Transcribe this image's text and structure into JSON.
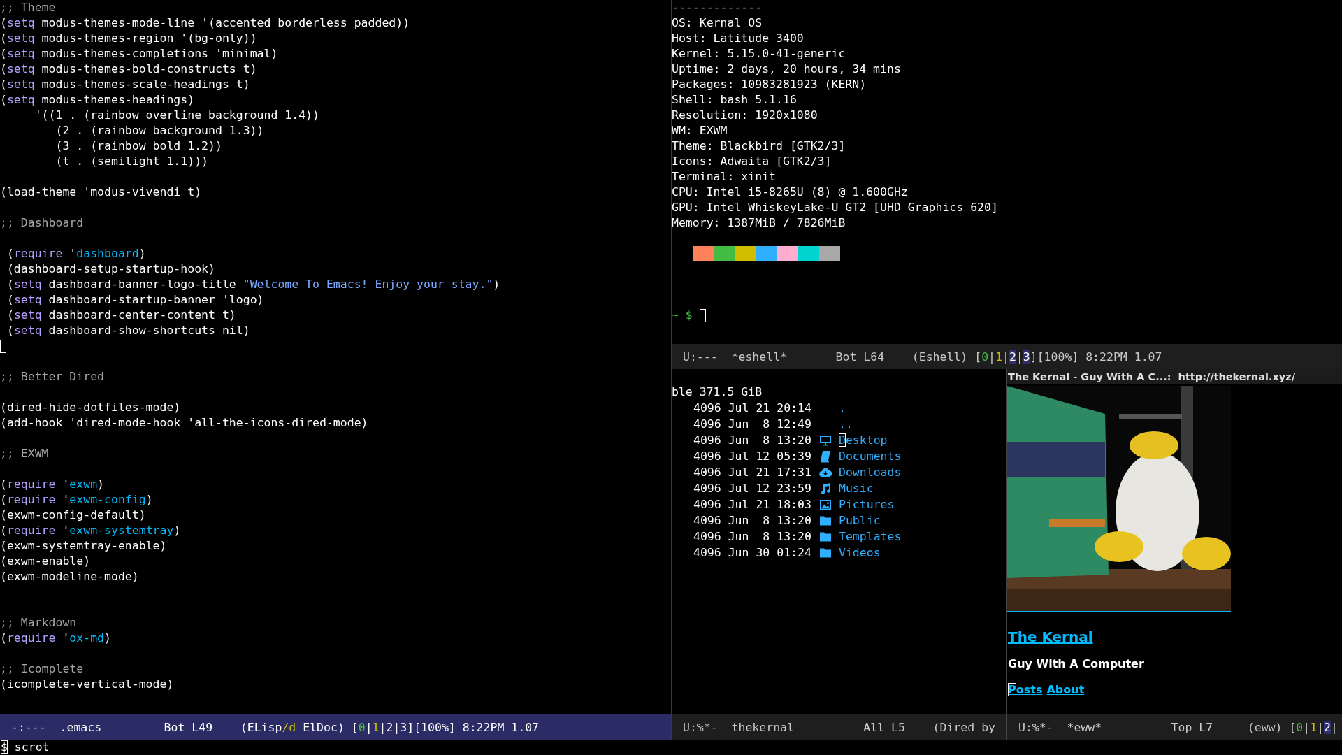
{
  "editor": {
    "lines": [
      {
        "kind": "code",
        "segments": [
          {
            "text": ";; Theme",
            "kind": "comment"
          }
        ]
      },
      {
        "kind": "code",
        "segments": [
          {
            "text": "("
          },
          {
            "text": "setq",
            "kind": "keyword"
          },
          {
            "text": " modus-themes-mode-line '(accented borderless padded))"
          }
        ]
      },
      {
        "kind": "code",
        "segments": [
          {
            "text": "("
          },
          {
            "text": "setq",
            "kind": "keyword"
          },
          {
            "text": " modus-themes-region '(bg-only))"
          }
        ]
      },
      {
        "kind": "code",
        "segments": [
          {
            "text": "("
          },
          {
            "text": "setq",
            "kind": "keyword"
          },
          {
            "text": " modus-themes-completions 'minimal)"
          }
        ]
      },
      {
        "kind": "code",
        "segments": [
          {
            "text": "("
          },
          {
            "text": "setq",
            "kind": "keyword"
          },
          {
            "text": " modus-themes-bold-constructs t)"
          }
        ]
      },
      {
        "kind": "code",
        "segments": [
          {
            "text": "("
          },
          {
            "text": "setq",
            "kind": "keyword"
          },
          {
            "text": " modus-themes-scale-headings t)"
          }
        ]
      },
      {
        "kind": "code",
        "segments": [
          {
            "text": "("
          },
          {
            "text": "setq",
            "kind": "keyword"
          },
          {
            "text": " modus-themes-headings)"
          }
        ]
      },
      {
        "kind": "code",
        "segments": [
          {
            "text": "     '((1 . (rainbow overline background 1.4))"
          }
        ]
      },
      {
        "kind": "code",
        "segments": [
          {
            "text": "        (2 . (rainbow background 1.3))"
          }
        ]
      },
      {
        "kind": "code",
        "segments": [
          {
            "text": "        (3 . (rainbow bold 1.2))"
          }
        ]
      },
      {
        "kind": "code",
        "segments": [
          {
            "text": "        (t . (semilight 1.1)))"
          }
        ]
      },
      {
        "kind": "blank"
      },
      {
        "kind": "code",
        "segments": [
          {
            "text": "(load-theme 'modus-vivendi t)"
          }
        ]
      },
      {
        "kind": "blank"
      },
      {
        "kind": "code",
        "segments": [
          {
            "text": ";; Dashboard",
            "kind": "comment"
          }
        ]
      },
      {
        "kind": "blank"
      },
      {
        "kind": "code",
        "segments": [
          {
            "text": " ("
          },
          {
            "text": "require",
            "kind": "keyword"
          },
          {
            "text": " '"
          },
          {
            "text": "dashboard",
            "kind": "constant"
          },
          {
            "text": ")"
          }
        ]
      },
      {
        "kind": "code",
        "segments": [
          {
            "text": " (dashboard-setup-startup-hook)"
          }
        ]
      },
      {
        "kind": "code",
        "segments": [
          {
            "text": " ("
          },
          {
            "text": "setq",
            "kind": "keyword"
          },
          {
            "text": " dashboard-banner-logo-title "
          },
          {
            "text": "\"Welcome To Emacs! Enjoy your stay.\"",
            "kind": "string"
          },
          {
            "text": ")"
          }
        ]
      },
      {
        "kind": "code",
        "segments": [
          {
            "text": " ("
          },
          {
            "text": "setq",
            "kind": "keyword"
          },
          {
            "text": " dashboard-startup-banner 'logo)"
          }
        ]
      },
      {
        "kind": "code",
        "segments": [
          {
            "text": " ("
          },
          {
            "text": "setq",
            "kind": "keyword"
          },
          {
            "text": " dashboard-center-content t)"
          }
        ]
      },
      {
        "kind": "code",
        "segments": [
          {
            "text": " ("
          },
          {
            "text": "setq",
            "kind": "keyword"
          },
          {
            "text": " dashboard-show-shortcuts nil)"
          }
        ]
      },
      {
        "kind": "cursor"
      },
      {
        "kind": "blank"
      },
      {
        "kind": "code",
        "segments": [
          {
            "text": ";; Better Dired",
            "kind": "comment"
          }
        ]
      },
      {
        "kind": "blank"
      },
      {
        "kind": "code",
        "segments": [
          {
            "text": "(dired-hide-dotfiles-mode)"
          }
        ]
      },
      {
        "kind": "code",
        "segments": [
          {
            "text": "(add-hook 'dired-mode-hook 'all-the-icons-dired-mode)"
          }
        ]
      },
      {
        "kind": "blank"
      },
      {
        "kind": "code",
        "segments": [
          {
            "text": ";; EXWM",
            "kind": "comment"
          }
        ]
      },
      {
        "kind": "blank"
      },
      {
        "kind": "code",
        "segments": [
          {
            "text": "("
          },
          {
            "text": "require",
            "kind": "keyword"
          },
          {
            "text": " '"
          },
          {
            "text": "exwm",
            "kind": "constant"
          },
          {
            "text": ")"
          }
        ]
      },
      {
        "kind": "code",
        "segments": [
          {
            "text": "("
          },
          {
            "text": "require",
            "kind": "keyword"
          },
          {
            "text": " '"
          },
          {
            "text": "exwm-config",
            "kind": "constant"
          },
          {
            "text": ")"
          }
        ]
      },
      {
        "kind": "code",
        "segments": [
          {
            "text": "(exwm-config-default)"
          }
        ]
      },
      {
        "kind": "code",
        "segments": [
          {
            "text": "("
          },
          {
            "text": "require",
            "kind": "keyword"
          },
          {
            "text": " '"
          },
          {
            "text": "exwm-systemtray",
            "kind": "constant"
          },
          {
            "text": ")"
          }
        ]
      },
      {
        "kind": "code",
        "segments": [
          {
            "text": "(exwm-systemtray-enable)"
          }
        ]
      },
      {
        "kind": "code",
        "segments": [
          {
            "text": "(exwm-enable)"
          }
        ]
      },
      {
        "kind": "code",
        "segments": [
          {
            "text": "(exwm-modeline-mode)"
          }
        ]
      },
      {
        "kind": "blank"
      },
      {
        "kind": "blank"
      },
      {
        "kind": "code",
        "segments": [
          {
            "text": ";; Markdown",
            "kind": "comment"
          }
        ]
      },
      {
        "kind": "code",
        "segments": [
          {
            "text": "("
          },
          {
            "text": "require",
            "kind": "keyword"
          },
          {
            "text": " '"
          },
          {
            "text": "ox-md",
            "kind": "constant"
          },
          {
            "text": ")"
          }
        ]
      },
      {
        "kind": "blank"
      },
      {
        "kind": "code",
        "segments": [
          {
            "text": ";; Icomplete",
            "kind": "comment"
          }
        ]
      },
      {
        "kind": "code",
        "segments": [
          {
            "text": "(icomplete-vertical-mode)"
          }
        ]
      }
    ],
    "mode_line": {
      "active": true,
      "segments": [
        {
          "text": "-:---  .emacs         Bot L49    (ELisp"
        },
        {
          "text": "/d",
          "kind": "yellow"
        },
        {
          "text": " ElDoc) ["
        },
        {
          "text": "0",
          "kind": "green"
        },
        {
          "text": "|"
        },
        {
          "text": "1",
          "kind": "yellow"
        },
        {
          "text": "|2|3][100%] 8:22PM 1.07"
        }
      ]
    }
  },
  "eshell": {
    "lines": [
      {
        "kind": "text",
        "text": "-------------"
      },
      {
        "kind": "text",
        "text": "OS: Kernal OS"
      },
      {
        "kind": "text",
        "text": "Host: Latitude 3400"
      },
      {
        "kind": "text",
        "text": "Kernel: 5.15.0-41-generic"
      },
      {
        "kind": "text",
        "text": "Uptime: 2 days, 20 hours, 34 mins"
      },
      {
        "kind": "text",
        "text": "Packages: 10983281923 (KERN)"
      },
      {
        "kind": "text",
        "text": "Shell: bash 5.1.16"
      },
      {
        "kind": "text",
        "text": "Resolution: 1920x1080"
      },
      {
        "kind": "text",
        "text": "WM: EXWM"
      },
      {
        "kind": "text",
        "text": "Theme: Blackbird [GTK2/3]"
      },
      {
        "kind": "text",
        "text": "Icons: Adwaita [GTK2/3]"
      },
      {
        "kind": "text",
        "text": "Terminal: xinit"
      },
      {
        "kind": "text",
        "text": "CPU: Intel i5-8265U (8) @ 1.600GHz"
      },
      {
        "kind": "text",
        "text": "GPU: Intel WhiskeyLake-U GT2 [UHD Graphics 620]"
      },
      {
        "kind": "text",
        "text": "Memory: 1387MiB / 7826MiB"
      },
      {
        "kind": "blank"
      },
      {
        "kind": "palette",
        "swatches": [
          {
            "color": "#ff8059"
          },
          {
            "color": "#44bc44"
          },
          {
            "color": "#d0bc00"
          },
          {
            "color": "#2fafff"
          },
          {
            "color": "#feacd0"
          },
          {
            "color": "#00d3d0"
          },
          {
            "color": "#a8a8a8"
          }
        ]
      },
      {
        "kind": "blank"
      },
      {
        "kind": "blank"
      },
      {
        "kind": "blank"
      },
      {
        "kind": "prompt",
        "text": "~ $",
        "cursor": true
      }
    ],
    "mode_line": {
      "active": false,
      "segments": [
        {
          "text": "U:---  *eshell*       Bot L64    (Eshell) ["
        },
        {
          "text": "0",
          "kind": "green"
        },
        {
          "text": "|"
        },
        {
          "text": "1",
          "kind": "yellow"
        },
        {
          "text": "|"
        },
        {
          "text": "2",
          "kind": "highlight"
        },
        {
          "text": "|"
        },
        {
          "text": "3",
          "kind": "highlight"
        },
        {
          "text": "][100%] 8:22PM 1.07"
        }
      ]
    }
  },
  "dired": {
    "header": "ble 371.5 GiB",
    "rows": [
      {
        "details": "4096 Jul 21 20:14",
        "kind": "current",
        "name": [
          {
            "text": "."
          }
        ]
      },
      {
        "details": "4096 Jun  8 12:49",
        "kind": "parent",
        "name": [
          {
            "text": ".."
          }
        ]
      },
      {
        "details": "4096 Jun  8 13:20",
        "kind": "desktop",
        "name": [
          {
            "text": "D",
            "kind": "cursor"
          },
          {
            "text": "esktop"
          }
        ]
      },
      {
        "details": "4096 Jul 12 05:39",
        "kind": "documents",
        "name": [
          {
            "text": "Documents"
          }
        ]
      },
      {
        "details": "4096 Jul 21 17:31",
        "kind": "downloads",
        "name": [
          {
            "text": "Downloads"
          }
        ]
      },
      {
        "details": "4096 Jul 12 23:59",
        "kind": "music",
        "name": [
          {
            "text": "Music"
          }
        ]
      },
      {
        "details": "4096 Jul 21 18:03",
        "kind": "pictures",
        "name": [
          {
            "text": "Pictures"
          }
        ]
      },
      {
        "details": "4096 Jun  8 13:20",
        "kind": "folder",
        "name": [
          {
            "text": "Public"
          }
        ]
      },
      {
        "details": "4096 Jun  8 13:20",
        "kind": "folder",
        "name": [
          {
            "text": "Templates"
          }
        ]
      },
      {
        "details": "4096 Jun 30 01:24",
        "kind": "folder",
        "name": [
          {
            "text": "Videos"
          }
        ]
      }
    ],
    "mode_line": {
      "active": false,
      "segments": [
        {
          "text": "U:%*-  thekernal          All L5    (Dired by"
        }
      ]
    }
  },
  "eww": {
    "header": "The Kernal - Guy With A C...:  http://thekernal.xyz/",
    "site_title": "The Kernal",
    "tagline": "Guy With A Computer",
    "links": [
      {
        "segments": [
          {
            "text": "P",
            "kind": "cursor"
          },
          {
            "text": "osts"
          }
        ]
      },
      {
        "segments": [
          {
            "text": "About"
          }
        ]
      }
    ],
    "mode_line": {
      "active": false,
      "segments": [
        {
          "text": "U:%*-  *eww*          Top L7     (eww) ["
        },
        {
          "text": "0",
          "kind": "green"
        },
        {
          "text": "|"
        },
        {
          "text": "1",
          "kind": "yellow"
        },
        {
          "text": "|"
        },
        {
          "text": "2",
          "kind": "highlight"
        },
        {
          "text": "|"
        }
      ]
    }
  },
  "minibuffer": {
    "segments": [
      {
        "text": "$",
        "kind": "cursor"
      },
      {
        "text": " scrot"
      }
    ]
  }
}
